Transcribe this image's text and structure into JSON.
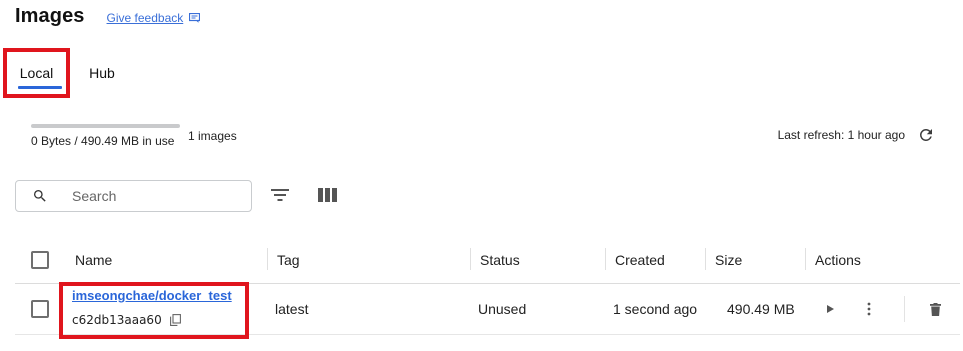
{
  "header": {
    "title": "Images",
    "feedback_label": "Give feedback"
  },
  "tabs": [
    {
      "label": "Local",
      "active": true
    },
    {
      "label": "Hub",
      "active": false
    }
  ],
  "usage": {
    "text": "0 Bytes / 490.49 MB in use",
    "fraction": 1.0,
    "images_count": "1 images"
  },
  "refresh": {
    "text": "Last refresh: 1 hour ago"
  },
  "search": {
    "placeholder": "Search",
    "value": ""
  },
  "table": {
    "columns": {
      "name": "Name",
      "tag": "Tag",
      "status": "Status",
      "created": "Created",
      "size": "Size",
      "actions": "Actions"
    },
    "rows": [
      {
        "name": "imseongchae/docker_test",
        "id": "c62db13aaa60",
        "tag": "latest",
        "status": "Unused",
        "created": "1 second ago",
        "size": "490.49 MB"
      }
    ]
  },
  "colors": {
    "accent": "#2a66d9",
    "highlight": "#e0151d",
    "usage_bar": "#c9cacc"
  },
  "icons": [
    "feedback-icon",
    "refresh-icon",
    "search-icon",
    "filter-icon",
    "columns-icon",
    "copy-icon",
    "run-icon",
    "more-icon",
    "delete-icon"
  ]
}
